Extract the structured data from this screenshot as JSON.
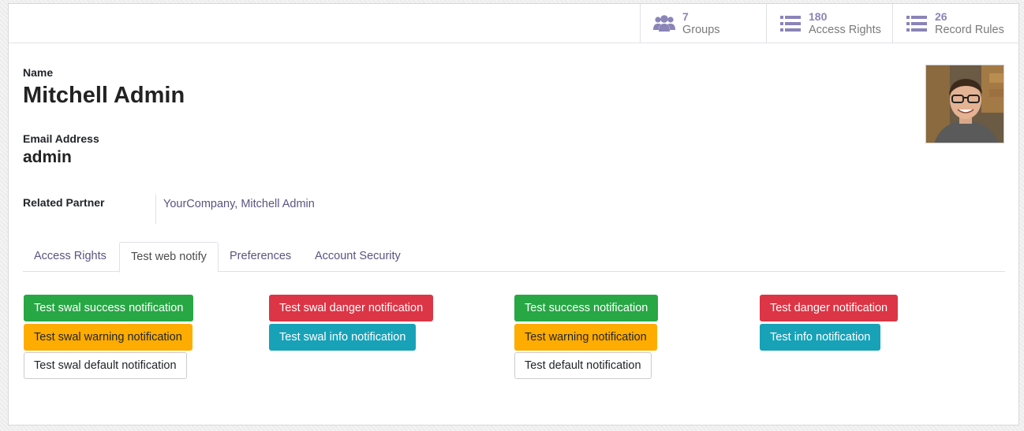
{
  "smart_buttons": [
    {
      "count": "7",
      "label": "Groups",
      "icon": "users-icon"
    },
    {
      "count": "180",
      "label": "Access Rights",
      "icon": "list-icon"
    },
    {
      "count": "26",
      "label": "Record Rules",
      "icon": "list-icon"
    }
  ],
  "form": {
    "name_label": "Name",
    "name_value": "Mitchell Admin",
    "email_label": "Email Address",
    "email_value": "admin",
    "partner_label": "Related Partner",
    "partner_value": "YourCompany, Mitchell Admin"
  },
  "tabs": [
    "Access Rights",
    "Test web notify",
    "Preferences",
    "Account Security"
  ],
  "active_tab": "Test web notify",
  "buttons": {
    "swal_success": "Test swal success notification",
    "swal_warning": "Test swal warning notification",
    "swal_default": "Test swal default notification",
    "swal_danger": "Test swal danger notification",
    "swal_info": "Test swal info notification",
    "success": "Test success notification",
    "warning": "Test warning notification",
    "default": "Test default notification",
    "danger": "Test danger notification",
    "info": "Test info notification"
  },
  "colors": {
    "success": "#28a745",
    "danger": "#dc3545",
    "warning": "#ffac00",
    "info": "#17a2b8",
    "accent": "#8a84b8"
  }
}
